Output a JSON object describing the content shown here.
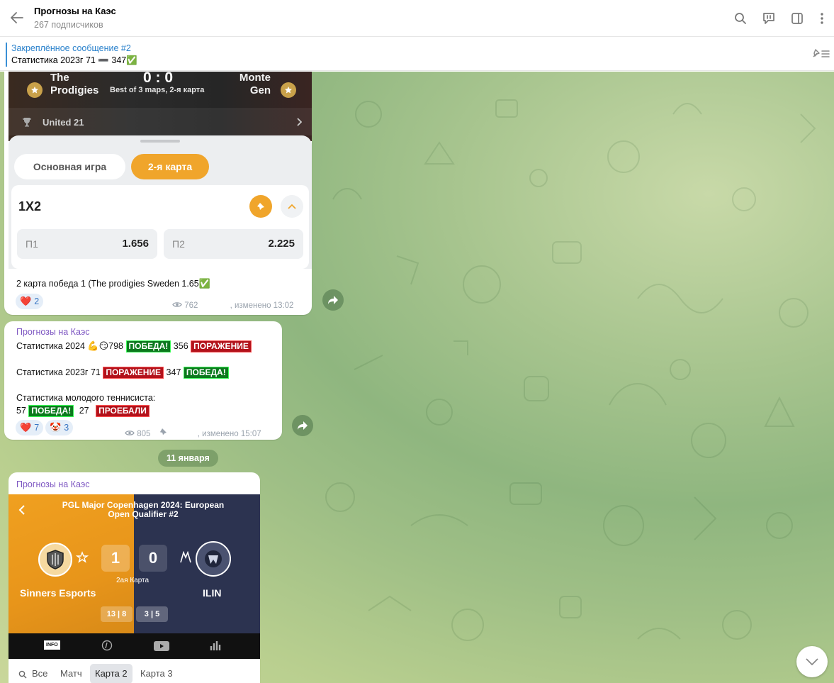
{
  "header": {
    "title": "Прогнозы на Каэс",
    "subscribers": "267 подписчиков",
    "icons": [
      "back-arrow-icon",
      "search-icon",
      "comments-icon",
      "sidebar-icon",
      "more-icon"
    ]
  },
  "pinned": {
    "title": "Закреплённое сообщение #2",
    "text": "Статистика 2023г 71 ➖ 347✅"
  },
  "messages": [
    {
      "image": {
        "team1": "The\nProdigies",
        "team1_line1": "The",
        "team1_line2": "Prodigies",
        "score": "0 : 0",
        "format": "Best of 3 maps, 2-я карта",
        "team2_line1": "Monte",
        "team2_line2": "Gen",
        "tournament": "United 21",
        "tabs": [
          "Основная игра",
          "2-я карта"
        ],
        "market": "1X2",
        "odds": [
          {
            "label": "П1",
            "value": "1.656"
          },
          {
            "label": "П2",
            "value": "2.225"
          }
        ]
      },
      "text": "2 карта победа 1 (The prodigies Sweden 1.65",
      "text_emoji": "✅",
      "reactions": [
        {
          "emoji": "❤️",
          "count": "2"
        }
      ],
      "views": "762",
      "edited": ", изменено 13:02"
    },
    {
      "author": "Прогнозы на Каэс",
      "line1_prefix": "Статистика 2024 ",
      "line1_emoji": "💪😏",
      "line1_num1": "798",
      "line1_num2": " 356",
      "line2_prefix": "Статистика 2023г 71 ",
      "line2_num": "347",
      "line3": "Статистика молодого теннисиста:",
      "line4_num1": "57",
      "line4_num2": "27",
      "badge_win": "ПОБЕДА!",
      "badge_loss": "ПОРАЖЕНИЕ",
      "badge_lost": "ПРОЕБАЛИ",
      "reactions": [
        {
          "emoji": "❤️",
          "count": "7"
        },
        {
          "emoji": "🤡",
          "count": "3"
        }
      ],
      "views": "805",
      "edited": ", изменено 15:07"
    },
    {
      "date": "11 января",
      "author": "Прогнозы на Каэс",
      "image": {
        "event": "PGL Major Copenhagen 2024: European Open Qualifier #2",
        "team1": "Sinners Esports",
        "team2": "ILIN",
        "score1": "1",
        "score2": "0",
        "map_label": "2ая Карта",
        "map_score1": "13 | 8",
        "map_score2": "3 | 5",
        "nav": [
          "INFO",
          "stats-icon",
          "video-icon",
          "chart-icon"
        ],
        "tabs": [
          "Все",
          "Матч",
          "Карта 2",
          "Карта 3"
        ]
      }
    }
  ],
  "colors": {
    "accent": "#2b82cc",
    "author": "#7e57c2",
    "orange": "#f0a52b",
    "win": "#0b7a1d",
    "loss": "#b3121b"
  }
}
